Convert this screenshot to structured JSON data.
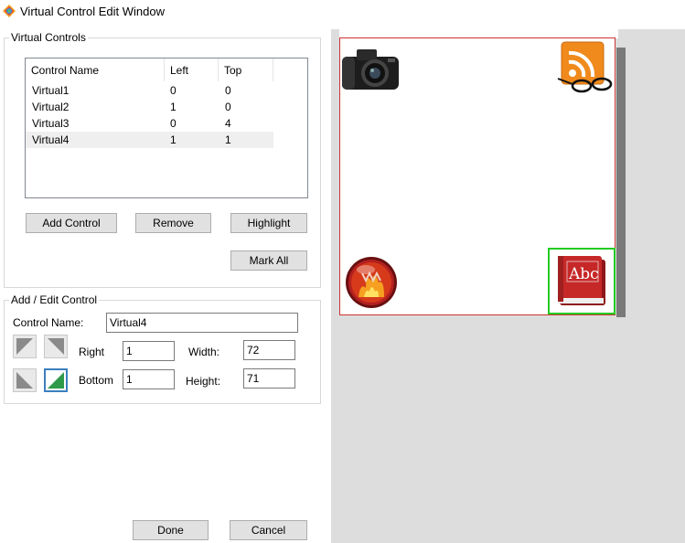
{
  "window": {
    "title": "Virtual Control Edit Window"
  },
  "virtual_controls_group": {
    "title": "Virtual Controls",
    "columns": [
      "Control Name",
      "Left",
      "Top"
    ],
    "rows": [
      {
        "name": "Virtual1",
        "left": "0",
        "top": "0"
      },
      {
        "name": "Virtual2",
        "left": "1",
        "top": "0"
      },
      {
        "name": "Virtual3",
        "left": "0",
        "top": "4"
      },
      {
        "name": "Virtual4",
        "left": "1",
        "top": "1"
      }
    ],
    "selected_row": "Virtual4",
    "buttons": {
      "add": "Add Control",
      "remove": "Remove",
      "highlight": "Highlight",
      "mark_all": "Mark All"
    }
  },
  "edit_group": {
    "title": "Add / Edit Control",
    "control_name_label": "Control Name:",
    "control_name_value": "Virtual4",
    "right_label": "Right",
    "right_value": "1",
    "bottom_label": "Bottom",
    "bottom_value": "1",
    "width_label": "Width:",
    "width_value": "72",
    "height_label": "Height:",
    "height_value": "71",
    "active_anchor": "bottom-right"
  },
  "footer": {
    "done": "Done",
    "cancel": "Cancel"
  },
  "preview": {
    "icons": [
      "camera-icon",
      "rss-reader-icon",
      "fire-emblem-icon",
      "dictionary-book-icon"
    ],
    "book_text": "Abc",
    "selection_color": "#22cc22",
    "frame_color": "#cc3333"
  }
}
